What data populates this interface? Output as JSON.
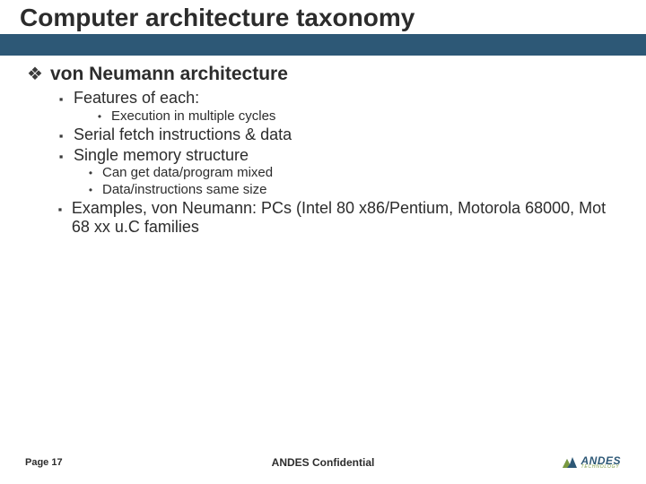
{
  "slide": {
    "title": "Computer architecture taxonomy",
    "sections": [
      {
        "bullet": "❖",
        "text": "von Neumann architecture",
        "level": 1
      },
      {
        "bullet": "▪",
        "text": "Features of each:",
        "level": 2
      },
      {
        "bullet": "•",
        "text": "Execution in multiple cycles",
        "level": 3,
        "indentExtra": true
      },
      {
        "bullet": "▪",
        "text": "Serial fetch instructions & data",
        "level": 2
      },
      {
        "bullet": "▪",
        "text": "Single memory  structure",
        "level": 2
      },
      {
        "bullet": "•",
        "text": "Can get data/program mixed",
        "level": 3
      },
      {
        "bullet": "•",
        "text": "Data/instructions same size",
        "level": 3
      },
      {
        "bullet": "▪",
        "text": "Examples, von Neumann: PCs (Intel 80 x86/Pentium, Motorola 68000, Mot 68 xx u.C families",
        "level": 2
      }
    ]
  },
  "footer": {
    "page": "Page 17",
    "confidential": "ANDES Confidential",
    "logo_top": "ANDES",
    "logo_bot": "TECHNOLOGY"
  },
  "colors": {
    "band": "#2d5876",
    "logo_blue": "#2d5876",
    "logo_green": "#7a9a3f"
  }
}
